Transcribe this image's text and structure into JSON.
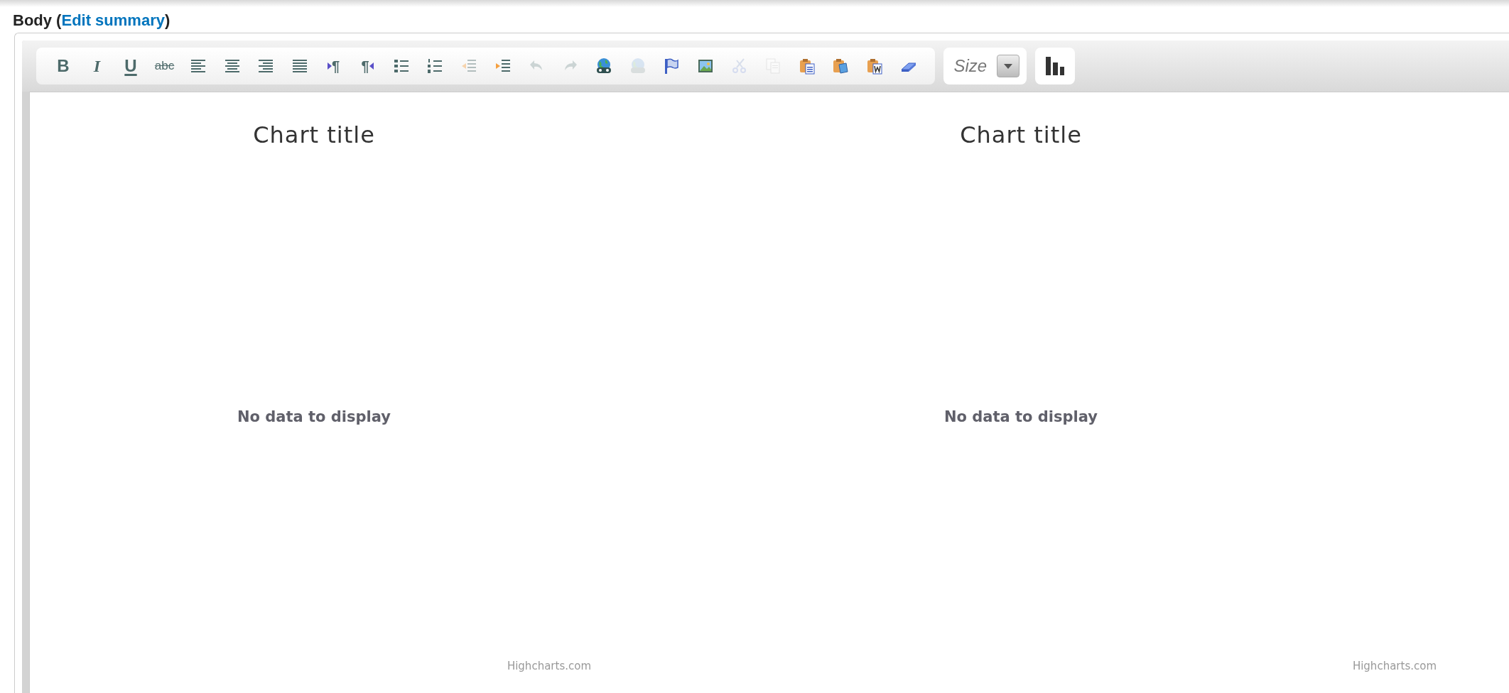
{
  "field": {
    "label_before": "Body (",
    "link": "Edit summary",
    "label_after": ")"
  },
  "toolbar": {
    "buttons": [
      {
        "kind": "bold",
        "label": "B",
        "disabled": false
      },
      {
        "kind": "italic",
        "label": "I",
        "disabled": false
      },
      {
        "kind": "underline",
        "label": "U",
        "disabled": false
      },
      {
        "kind": "strike",
        "label": "abc",
        "disabled": false
      },
      {
        "kind": "alignleft",
        "disabled": false
      },
      {
        "kind": "aligncenter",
        "disabled": false
      },
      {
        "kind": "alignright",
        "disabled": false
      },
      {
        "kind": "justify",
        "disabled": false
      },
      {
        "kind": "ltr",
        "label": "¶",
        "disabled": false
      },
      {
        "kind": "rtl",
        "label": "¶",
        "disabled": false
      },
      {
        "kind": "bullets",
        "disabled": false
      },
      {
        "kind": "numbers",
        "disabled": false
      },
      {
        "kind": "outdent",
        "disabled": true
      },
      {
        "kind": "indent",
        "disabled": false
      },
      {
        "kind": "undo",
        "disabled": true
      },
      {
        "kind": "redo",
        "disabled": true
      },
      {
        "kind": "link",
        "disabled": false
      },
      {
        "kind": "unlink",
        "disabled": true
      },
      {
        "kind": "flag",
        "disabled": false
      },
      {
        "kind": "image",
        "disabled": false
      },
      {
        "kind": "cut",
        "disabled": true
      },
      {
        "kind": "copy",
        "disabled": true
      },
      {
        "kind": "paste",
        "disabled": false
      },
      {
        "kind": "pastetext",
        "disabled": false
      },
      {
        "kind": "pasteword",
        "disabled": false
      },
      {
        "kind": "eraser",
        "disabled": false
      }
    ],
    "size_select": {
      "placeholder": "Size"
    }
  },
  "charts": [
    {
      "title": "Chart title",
      "message": "No data to display",
      "credit": "Highcharts.com"
    },
    {
      "title": "Chart title",
      "message": "No data to display",
      "credit": "Highcharts.com"
    }
  ]
}
